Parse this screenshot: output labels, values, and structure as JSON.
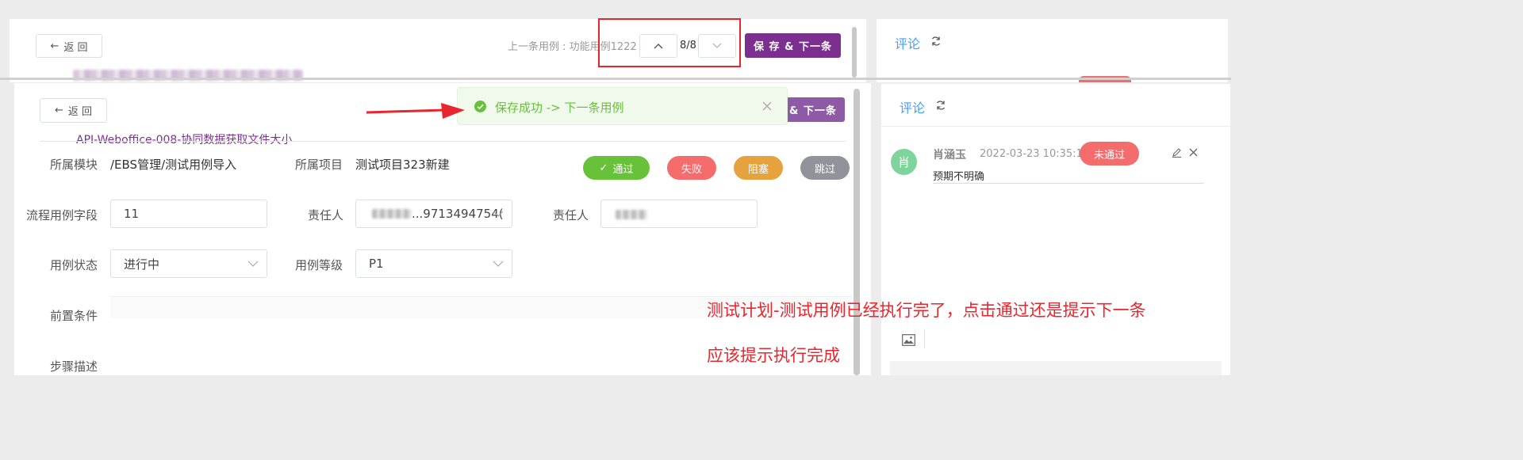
{
  "back_label": "返 回",
  "save_next_label": "保 存 & 下一条",
  "save_next_partial": "& 下一条",
  "prev_case_text": "上一条用例 : 功能用例1222",
  "pager": "8/8",
  "title_partial": "/...件大小",
  "case_title": "API-Weboffice-008-协同数据获取文件大小",
  "toast": {
    "message": "保存成功 -> 下一条用例"
  },
  "fields": {
    "module_label": "所属模块",
    "module_value": "/EBS管理/测试用例导入",
    "project_label": "所属项目",
    "project_value": "测试项目323新建",
    "flow_label": "流程用例字段",
    "flow_value": "11",
    "owner_label": "责任人",
    "owner_value": "...9713494754(",
    "owner2_label": "责任人",
    "status_label": "用例状态",
    "status_value": "进行中",
    "level_label": "用例等级",
    "level_value": "P1",
    "precondition_label": "前置条件",
    "steps_label": "步骤描述"
  },
  "actions": {
    "pass": "通过",
    "fail": "失败",
    "block": "阻塞",
    "skip": "跳过"
  },
  "comments": {
    "title": "评论",
    "avatar": "肖",
    "author": "肖涵玉",
    "time": "2022-03-23 10:35:15",
    "badge": "未通过",
    "text": "预期不明确"
  },
  "annotations": {
    "line1": "测试计划-测试用例已经执行完了，点击通过还是提示下一条",
    "line2": "应该提示执行完成"
  },
  "colors": {
    "purple": "#7b2f8e",
    "pass": "#67c23a",
    "fail": "#f56c6c",
    "block": "#e6a23c",
    "skip": "#909399",
    "annotation_red": "#e8262e",
    "toast_bg": "#f0f9eb"
  }
}
